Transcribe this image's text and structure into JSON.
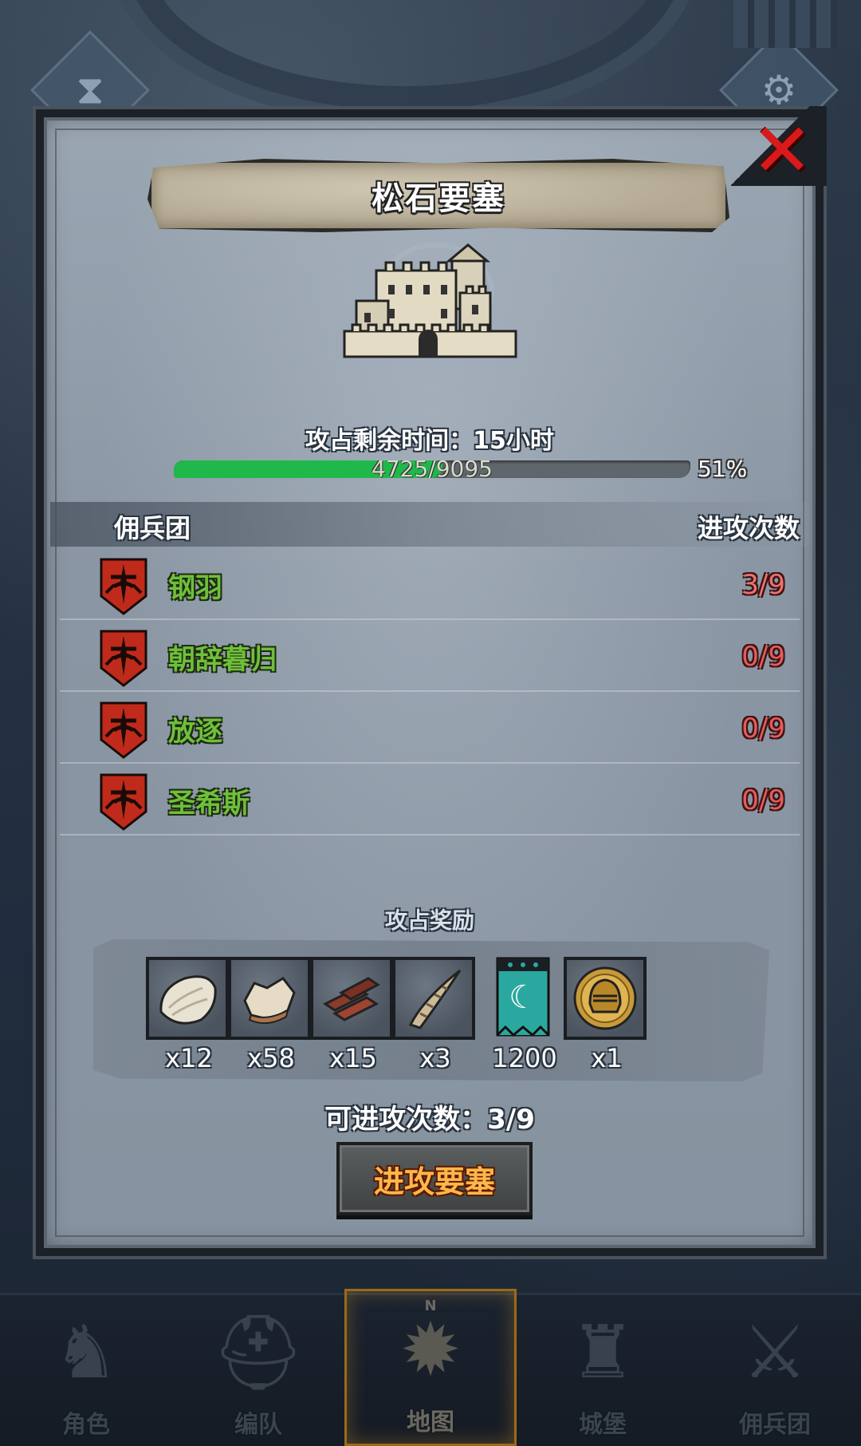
{
  "fortress": {
    "title": "松石要塞",
    "timer_label": "攻占剩余时间：",
    "timer_value": "15小时",
    "progress_current": 4725,
    "progress_max": 9095,
    "progress_text": "4725/9095",
    "progress_percent": "51%"
  },
  "table": {
    "col_mercenary": "佣兵团",
    "col_attacks": "进攻次数",
    "rows": [
      {
        "name": "钢羽",
        "count": "3/9"
      },
      {
        "name": "朝辞暮归",
        "count": "0/9"
      },
      {
        "name": "放逐",
        "count": "0/9"
      },
      {
        "name": "圣希斯",
        "count": "0/9"
      }
    ]
  },
  "rewards": {
    "title": "攻占奖励",
    "items": [
      {
        "icon": "fur-pelt-icon",
        "qty": "x12"
      },
      {
        "icon": "leather-hide-icon",
        "qty": "x58"
      },
      {
        "icon": "wood-planks-icon",
        "qty": "x15"
      },
      {
        "icon": "horn-icon",
        "qty": "x3"
      },
      {
        "icon": "guild-banner-icon",
        "qty": "1200"
      },
      {
        "icon": "knight-helmet-coin-icon",
        "qty": "x1"
      }
    ]
  },
  "attack": {
    "remaining_label": "可进攻次数：",
    "remaining_value": "3/9",
    "button_label": "进攻要塞"
  },
  "bottom_nav": {
    "items": [
      {
        "label": "角色",
        "icon": "knight-icon"
      },
      {
        "label": "编队",
        "icon": "helmet-icon"
      },
      {
        "label": "地图",
        "icon": "compass-icon"
      },
      {
        "label": "城堡",
        "icon": "castle-icon"
      },
      {
        "label": "佣兵团",
        "icon": "mercenary-icon"
      }
    ],
    "compass_letter": "N"
  },
  "colors": {
    "progress_fill": "#1fb84a",
    "merc_name": "#6ec03a",
    "attack_count": "#e85a5a",
    "close_x": "#d91a1a",
    "button_text": "#ffb64a"
  }
}
